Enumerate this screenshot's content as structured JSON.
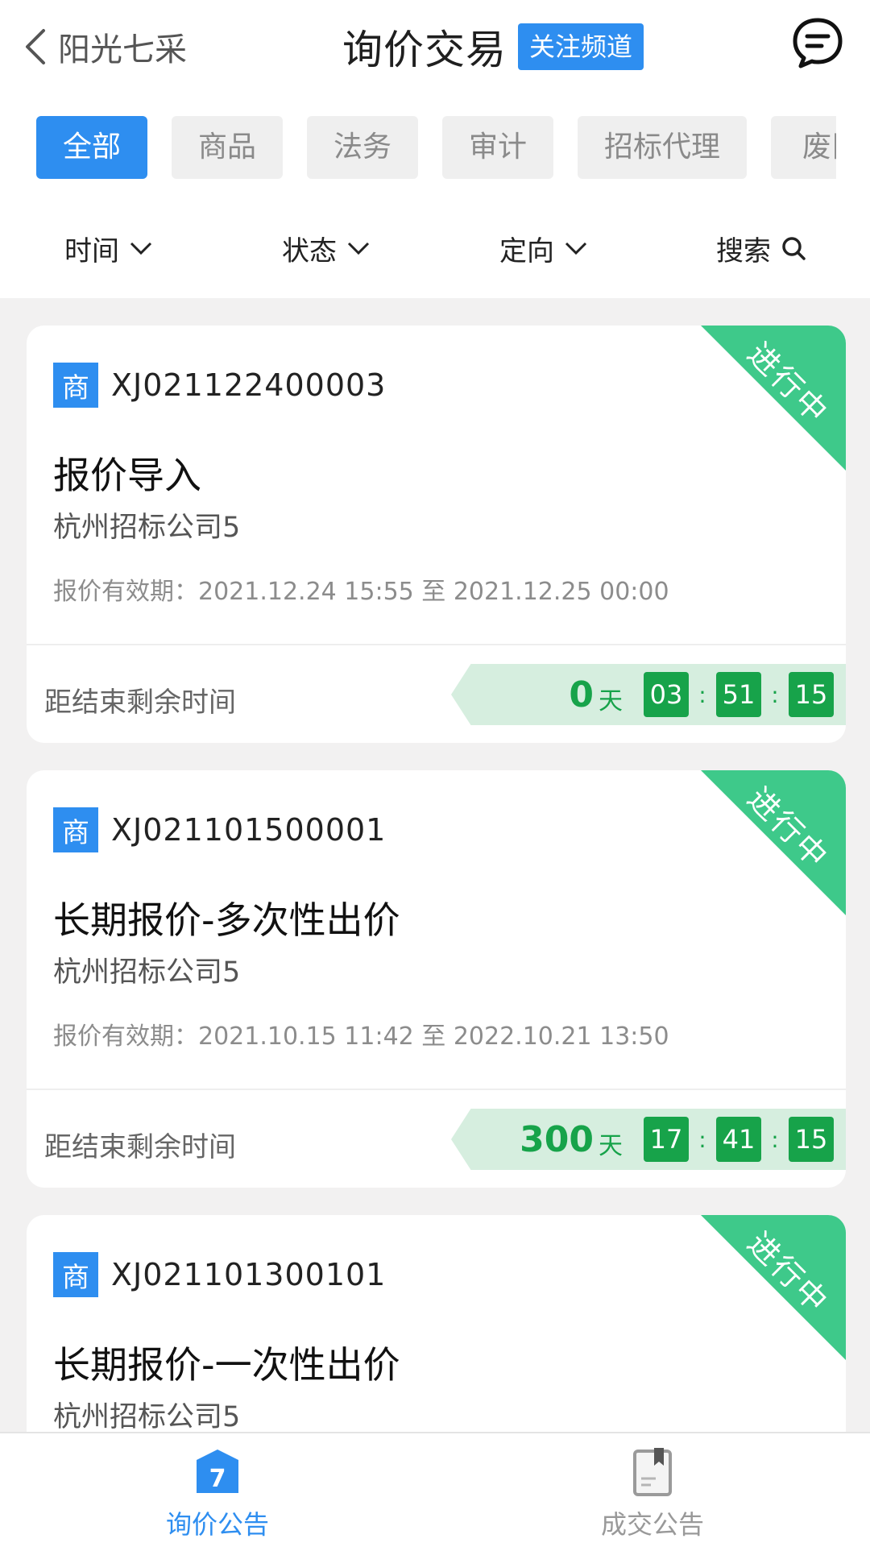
{
  "header": {
    "back_label": "阳光七采",
    "title": "询价交易",
    "follow_label": "关注频道"
  },
  "categories": [
    {
      "label": "全部",
      "active": true
    },
    {
      "label": "商品",
      "active": false
    },
    {
      "label": "法务",
      "active": false
    },
    {
      "label": "审计",
      "active": false
    },
    {
      "label": "招标代理",
      "active": false
    },
    {
      "label": "废旧",
      "active": false
    }
  ],
  "filters": {
    "time": "时间",
    "status": "状态",
    "direction": "定向",
    "search": "搜索"
  },
  "cards": [
    {
      "badge": "商",
      "code": "XJ021122400003",
      "status": "进行中",
      "title": "报价导入",
      "company": "杭州招标公司5",
      "validity": "报价有效期：2021.12.24 15:55 至 2021.12.25 00:00",
      "remain_label": "距结束剩余时间",
      "days": "0",
      "days_unit": "天",
      "hours": "03",
      "minutes": "51",
      "seconds": "15"
    },
    {
      "badge": "商",
      "code": "XJ021101500001",
      "status": "进行中",
      "title": "长期报价-多次性出价",
      "company": "杭州招标公司5",
      "validity": "报价有效期：2021.10.15 11:42 至 2022.10.21 13:50",
      "remain_label": "距结束剩余时间",
      "days": "300",
      "days_unit": "天",
      "hours": "17",
      "minutes": "41",
      "seconds": "15"
    },
    {
      "badge": "商",
      "code": "XJ021101300101",
      "status": "进行中",
      "title": "长期报价-一次性出价",
      "company": "杭州招标公司5"
    }
  ],
  "tabbar": {
    "inquiry_label": "询价公告",
    "inquiry_icon_number": "7",
    "deal_label": "成交公告"
  },
  "colors": {
    "accent": "#2e8ef0",
    "status_green": "#3ec98a",
    "countdown_green": "#17a34a",
    "countdown_bg": "#d6eedf"
  },
  "icons": {
    "back": "chevron-left-icon",
    "message": "message-icon",
    "dropdown": "chevron-down-icon",
    "search": "search-icon",
    "inquiry_tab": "calendar-icon",
    "deal_tab": "bookmark-doc-icon"
  }
}
